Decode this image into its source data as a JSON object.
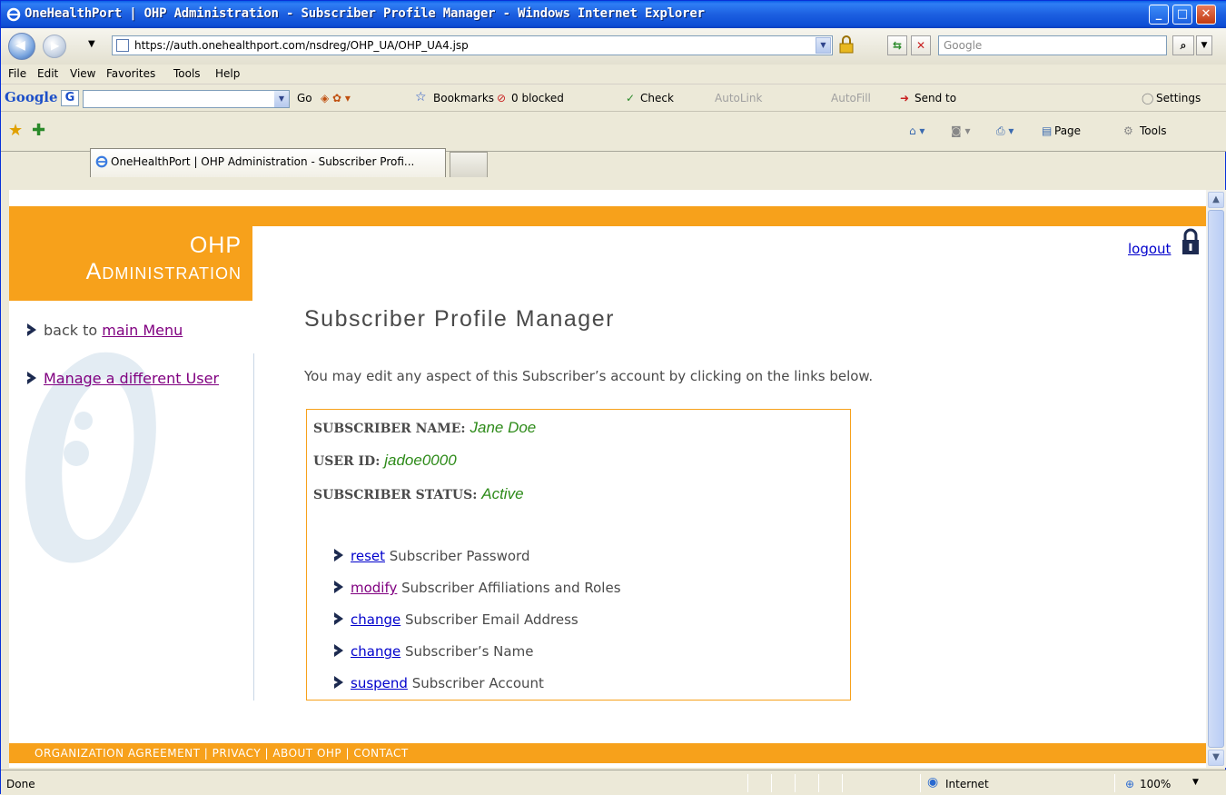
{
  "window": {
    "title": "OneHealthPort | OHP Administration - Subscriber Profile Manager - Windows Internet Explorer"
  },
  "address": {
    "url": "https://auth.onehealthport.com/nsdreg/OHP_UA/OHP_UA4.jsp",
    "search_placeholder": "Google"
  },
  "menu": [
    "File",
    "Edit",
    "View",
    "Favorites",
    "Tools",
    "Help"
  ],
  "google_toolbar": {
    "logo": "Google",
    "go": "Go",
    "bookmarks": "Bookmarks",
    "blocked": "0 blocked",
    "check": "Check",
    "autolink": "AutoLink",
    "autofill": "AutoFill",
    "sendto": "Send to",
    "settings": "Settings"
  },
  "tab": {
    "label": "OneHealthPort | OHP Administration - Subscriber Profi..."
  },
  "command_bar": {
    "page": "Page",
    "tools": "Tools"
  },
  "page": {
    "logo_line1": "OHP",
    "logo_line2": "Administration",
    "back_prefix": "back to ",
    "back_link": "main Menu",
    "manage_link": "Manage a different User",
    "logout": "logout",
    "title": "Subscriber Profile Manager",
    "intro": "You may edit any aspect of this Subscriber’s account by clicking on the links below.",
    "fields": [
      {
        "label": "SUBSCRIBER NAME:",
        "value": "Jane Doe"
      },
      {
        "label": "USER ID:",
        "value": "jadoe0000"
      },
      {
        "label": "SUBSCRIBER STATUS:",
        "value": "Active"
      }
    ],
    "options": [
      {
        "link": "reset",
        "text": " Subscriber Password"
      },
      {
        "link": "modify",
        "text": " Subscriber Affiliations and Roles"
      },
      {
        "link": "change",
        "text": " Subscriber Email Address"
      },
      {
        "link": "change",
        "text": " Subscriber’s Name"
      },
      {
        "link": "suspend",
        "text": " Subscriber Account"
      }
    ],
    "footer": "ORGANIZATION AGREEMENT | PRIVACY | ABOUT OHP | CONTACT"
  },
  "status": {
    "text": "Done",
    "zone": "Internet",
    "zoom": "100%"
  },
  "colors": {
    "accent": "#f7a11b",
    "value_green": "#2e8b1a",
    "link_blue": "#0000cc",
    "link_visited": "#800080"
  }
}
